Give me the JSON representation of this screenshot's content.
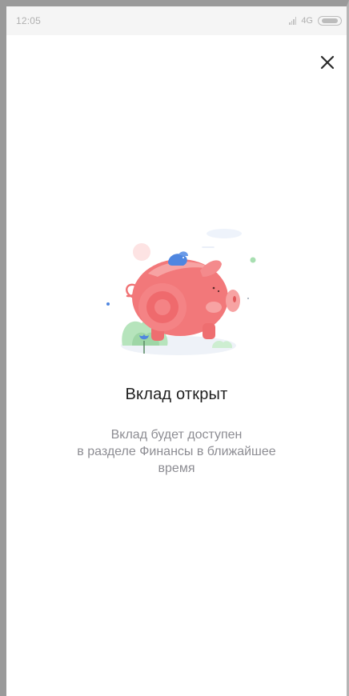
{
  "status_bar": {
    "time": "12:05",
    "network": "4G",
    "signal_icon": "signal-icon",
    "battery_icon": "battery-icon"
  },
  "header": {
    "close_icon": "close-icon"
  },
  "main": {
    "illustration": "piggy-bank-illustration",
    "title": "Вклад открыт",
    "description_lines": [
      "Вклад будет доступен",
      "в разделе Финансы в ближайшее",
      "время"
    ]
  },
  "colors": {
    "pig": "#f2787a",
    "pig_light": "#f7a3a3",
    "coin_bird": "#4f86e0",
    "plant": "#9fd8a6",
    "ground": "#eef2f8",
    "title_text": "#1f1f1f",
    "description_text": "#8d8d93"
  }
}
